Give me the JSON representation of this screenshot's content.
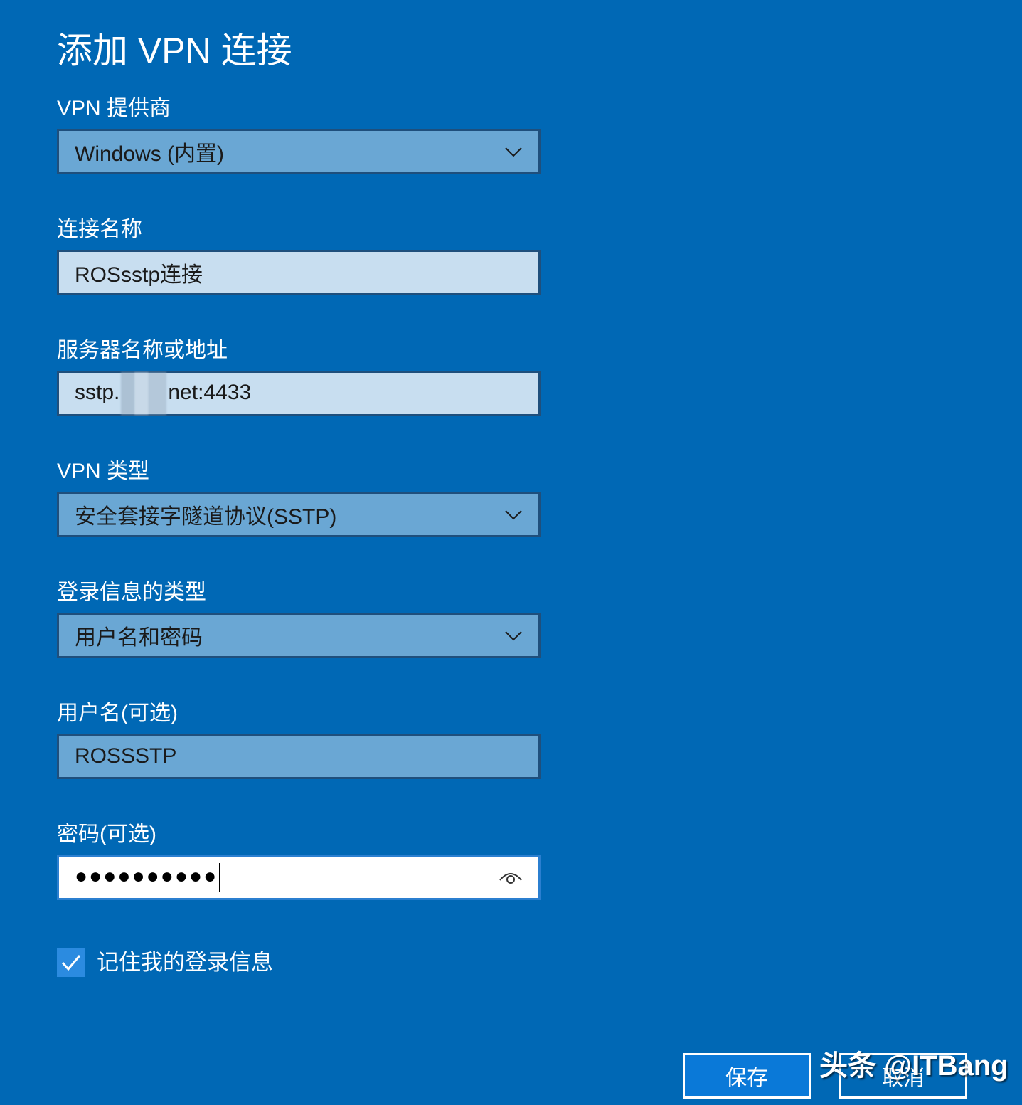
{
  "dialog": {
    "title": "添加 VPN 连接"
  },
  "form": {
    "provider": {
      "label": "VPN 提供商",
      "value": "Windows (内置)"
    },
    "connection_name": {
      "label": "连接名称",
      "value": "ROSsstp连接"
    },
    "server": {
      "label": "服务器名称或地址",
      "value_prefix": "sstp.",
      "value_suffix": "net:4433"
    },
    "vpn_type": {
      "label": "VPN 类型",
      "value": "安全套接字隧道协议(SSTP)"
    },
    "sign_in_type": {
      "label": "登录信息的类型",
      "value": "用户名和密码"
    },
    "username": {
      "label": "用户名(可选)",
      "value": "ROSSSTP"
    },
    "password": {
      "label": "密码(可选)",
      "masked_value": "●●●●●●●●●●"
    },
    "remember": {
      "label": "记住我的登录信息",
      "checked": true
    }
  },
  "buttons": {
    "save": "保存",
    "cancel": "取消"
  },
  "watermark": "头条 @ITBang",
  "icons": {
    "dropdown": "chevron-down-icon",
    "reveal_password": "eye-icon",
    "checkbox": "checkmark-icon"
  },
  "colors": {
    "background": "#0068b5",
    "dropdown_fill": "#6aa7d4",
    "textbox_fill": "#c8def0",
    "checkbox_fill": "#2b8be0",
    "primary_button": "#0a79d8"
  }
}
